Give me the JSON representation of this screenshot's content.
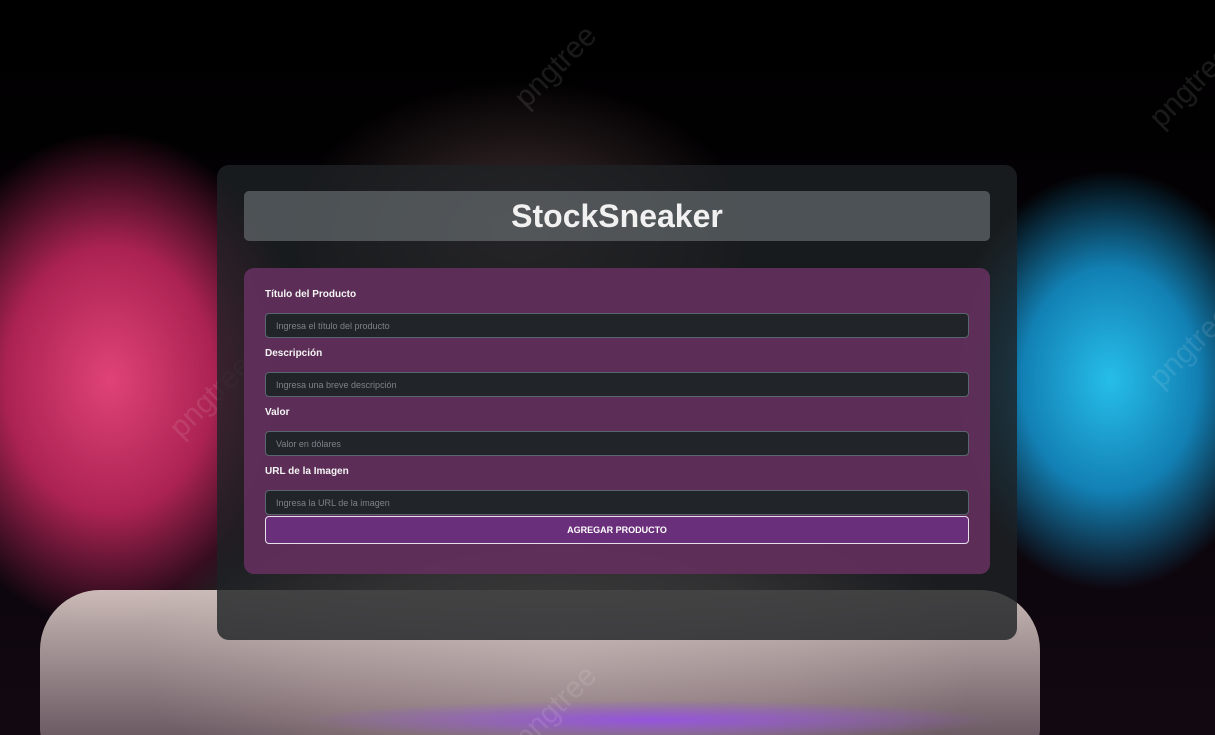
{
  "app": {
    "title": "StockSneaker"
  },
  "form": {
    "fields": [
      {
        "label": "Título del Producto",
        "placeholder": "Ingresa el título del producto",
        "value": ""
      },
      {
        "label": "Descripción",
        "placeholder": "Ingresa una breve descripción",
        "value": ""
      },
      {
        "label": "Valor",
        "placeholder": "Valor en dólares",
        "value": ""
      },
      {
        "label": "URL de la Imagen",
        "placeholder": "Ingresa la URL de la imagen",
        "value": ""
      }
    ],
    "submit_label": "AGREGAR PRODUCTO"
  },
  "background": {
    "watermark_text": "pngtree",
    "colors": {
      "pink_sneaker": "#e0457a",
      "blue_sneaker": "#2fc6f0",
      "white_sneaker": "#d8cbc6"
    }
  },
  "colors": {
    "panel": "#1e2224",
    "header_bar": "#787f84",
    "form_card": "#62305c",
    "input_bg": "#212529",
    "button_bg": "#6a2f7a"
  }
}
